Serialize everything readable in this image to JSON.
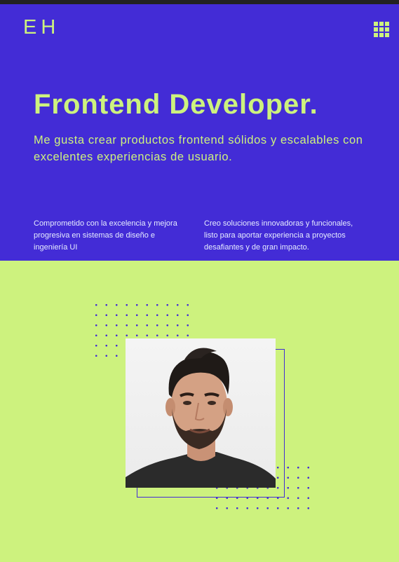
{
  "header": {
    "logo": "EH",
    "menu_icon": "grid-menu-icon"
  },
  "hero": {
    "title": "Frontend Developer.",
    "subtitle": "Me gusta crear productos frontend sólidos y escalables con excelentes experiencias de usuario.",
    "column_1": "Comprometido con la excelencia y mejora progresiva en sistemas de diseño e ingeniería UI",
    "column_2": "Creo soluciones innovadoras y funcionales, listo para aportar experiencia a proyectos desafiantes y de gran impacto."
  },
  "colors": {
    "primary": "#432cd6",
    "accent": "#cdf27e",
    "topbar": "#222222"
  }
}
